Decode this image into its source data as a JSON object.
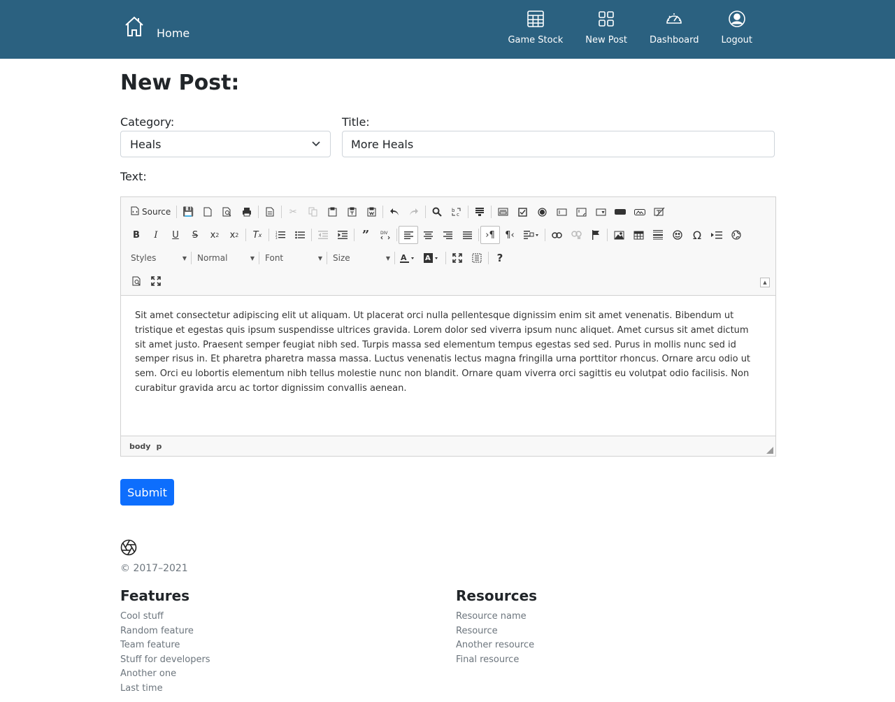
{
  "nav": {
    "home_label": "Home",
    "items": [
      {
        "label": "Game Stock",
        "icon": "table-icon"
      },
      {
        "label": "New Post",
        "icon": "grid-icon"
      },
      {
        "label": "Dashboard",
        "icon": "speedometer-icon"
      },
      {
        "label": "Logout",
        "icon": "person-circle-icon"
      }
    ],
    "colors": {
      "navbar_bg": "#2b6180",
      "primary": "#0d6efd"
    }
  },
  "page": {
    "title": "New Post:"
  },
  "form": {
    "category_label": "Category:",
    "category_value": "Heals",
    "title_label": "Title:",
    "title_value": "More Heals",
    "text_label": "Text:",
    "submit_label": "Submit"
  },
  "editor": {
    "source_label": "Source",
    "combos": {
      "styles": "Styles",
      "format": "Normal",
      "font": "Font",
      "size": "Size"
    },
    "content": "Sit amet consectetur adipiscing elit ut aliquam. Ut placerat orci nulla pellentesque dignissim enim sit amet venenatis. Bibendum ut tristique et egestas quis ipsum suspendisse ultrices gravida. Lorem dolor sed viverra ipsum nunc aliquet. Amet cursus sit amet dictum sit amet justo. Praesent semper feugiat nibh sed. Turpis massa sed elementum tempus egestas sed sed. Purus in mollis nunc sed id semper risus in. Et pharetra pharetra massa massa. Luctus venenatis lectus magna fringilla urna porttitor rhoncus. Ornare arcu odio ut sem. Orci eu lobortis elementum nibh tellus molestie nunc non blandit. Ornare quam viverra orci sagittis eu volutpat odio facilisis. Non curabitur gravida arcu ac tortor dignissim convallis aenean.",
    "path": [
      "body",
      "p"
    ]
  },
  "footer": {
    "copyright": "© 2017–2021",
    "features_title": "Features",
    "features": [
      "Cool stuff",
      "Random feature",
      "Team feature",
      "Stuff for developers",
      "Another one",
      "Last time"
    ],
    "resources_title": "Resources",
    "resources": [
      "Resource name",
      "Resource",
      "Another resource",
      "Final resource"
    ]
  }
}
